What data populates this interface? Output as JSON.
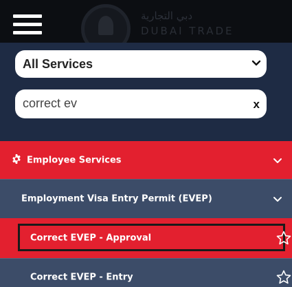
{
  "header": {
    "logo_arabic": "دبي التجارية",
    "logo_text": "DUBAI TRADE"
  },
  "search": {
    "service_select_value": "All Services",
    "query_value": "correct ev",
    "clear_label": "x"
  },
  "menu": {
    "category_label": "Employee Services",
    "subcategory_label": "Employment Visa Entry Permit (EVEP)",
    "results": [
      {
        "label": "Correct EVEP - Approval"
      },
      {
        "label": "Correct EVEP - Entry"
      }
    ]
  },
  "colors": {
    "brand_red": "#e3202f",
    "nav_navy": "#1e2b44",
    "row_slate": "#3c4c68",
    "header_black": "#0c0e12"
  }
}
